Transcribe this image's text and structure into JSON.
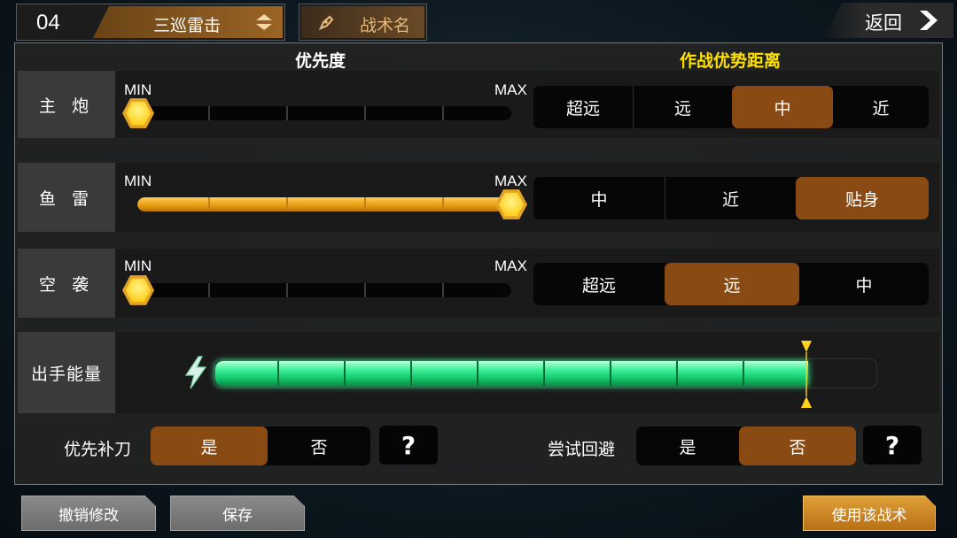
{
  "header": {
    "number": "04",
    "title": "三巡雷击",
    "tactic_name_label": "战术名",
    "back_label": "返回"
  },
  "columns": {
    "priority": "优先度",
    "distance": "作战优势距离"
  },
  "slider_labels": {
    "min": "MIN",
    "max": "MAX"
  },
  "rows": [
    {
      "label": "主 炮",
      "priority_fraction": 0.0,
      "options": [
        "超远",
        "远",
        "中",
        "近"
      ],
      "selected": 2
    },
    {
      "label": "鱼 雷",
      "priority_fraction": 1.0,
      "options": [
        "中",
        "近",
        "贴身"
      ],
      "selected": 2
    },
    {
      "label": "空 袭",
      "priority_fraction": 0.0,
      "options": [
        "超远",
        "远",
        "中"
      ],
      "selected": 1
    }
  ],
  "energy": {
    "label": "出手能量",
    "fill_fraction": 0.9
  },
  "toggles": [
    {
      "label": "优先补刀",
      "options": [
        "是",
        "否"
      ],
      "selected": 0,
      "help": "?"
    },
    {
      "label": "尝试回避",
      "options": [
        "是",
        "否"
      ],
      "selected": 1,
      "help": "?"
    }
  ],
  "buttons": {
    "undo": "撤销修改",
    "save": "保存",
    "use": "使用该战术"
  },
  "colors": {
    "accent_orange": "#8a4a14",
    "knob_yellow": "#ffd21c",
    "energy_green": "#3df09a",
    "distance_header": "#ffe000"
  }
}
